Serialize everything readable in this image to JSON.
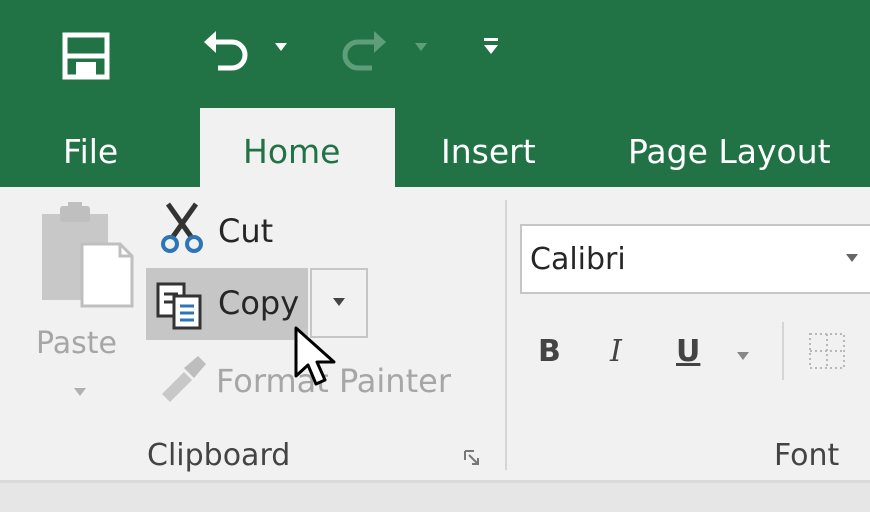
{
  "quick_access": {
    "save_icon": "save-icon",
    "undo_icon": "undo-icon",
    "redo_icon": "redo-icon",
    "customize_icon": "customize-qat-icon"
  },
  "tabs": [
    {
      "label": "File"
    },
    {
      "label": "Home",
      "active": true
    },
    {
      "label": "Insert"
    },
    {
      "label": "Page Layout"
    }
  ],
  "clipboard": {
    "paste_label": "Paste",
    "cut_label": "Cut",
    "copy_label": "Copy",
    "format_painter_label": "Format Painter",
    "group_label": "Clipboard"
  },
  "font": {
    "font_name": "Calibri",
    "bold": "B",
    "italic": "I",
    "underline": "U",
    "group_label": "Font"
  },
  "colors": {
    "excel_green": "#217346",
    "ribbon_bg": "#f1f1f1",
    "hover_gray": "#c6c6c6",
    "disabled_text": "#a6a6a6"
  }
}
